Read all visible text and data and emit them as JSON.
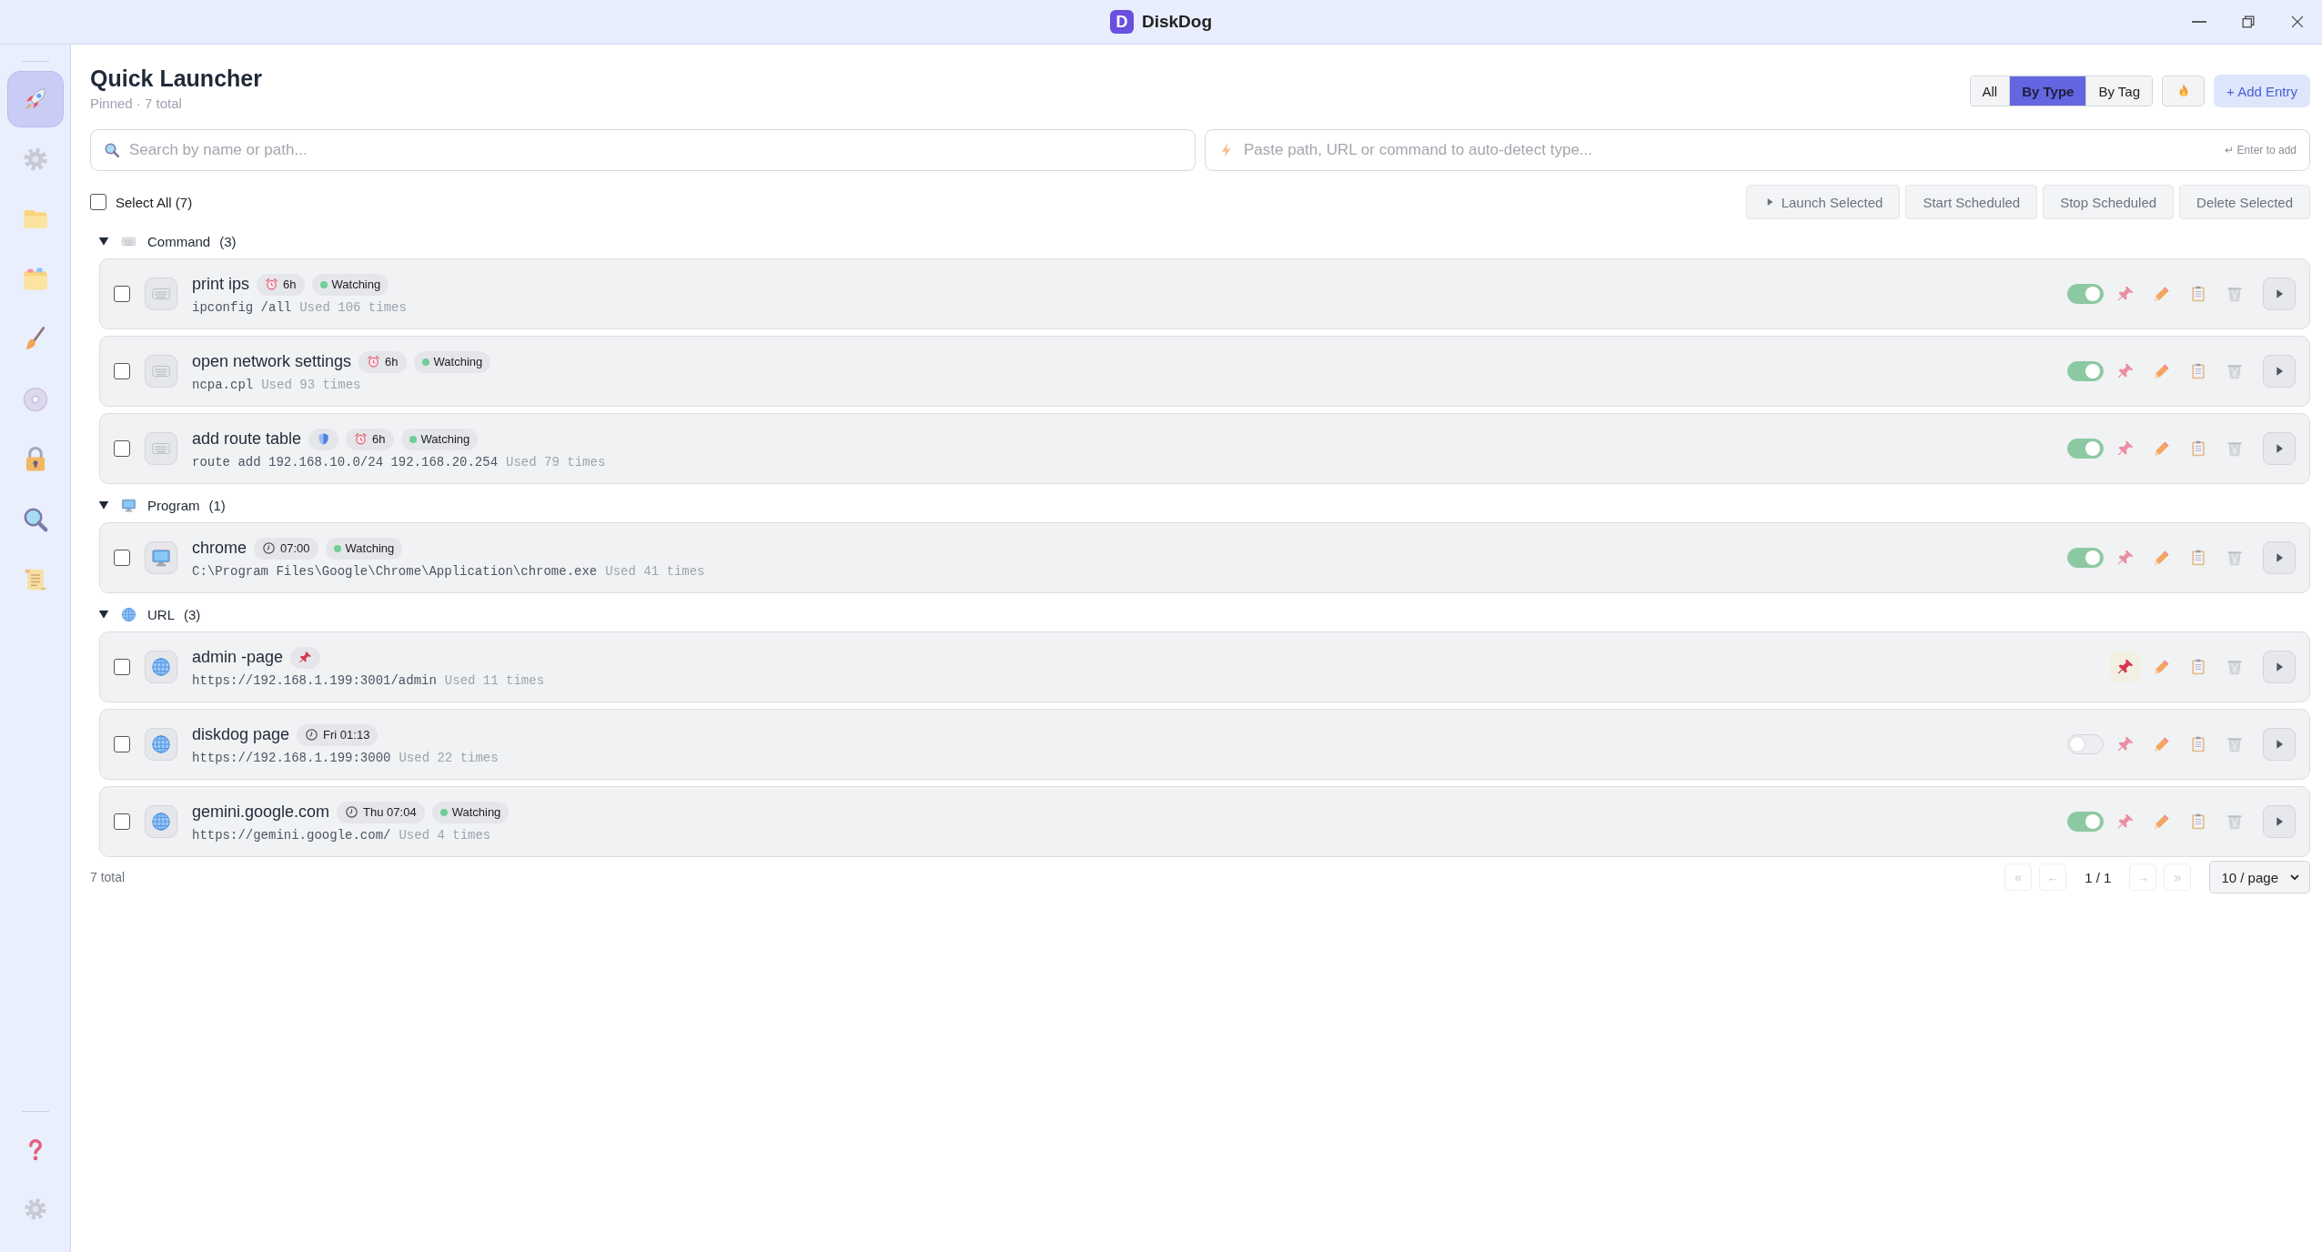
{
  "window": {
    "logo_letter": "D",
    "title": "DiskDog"
  },
  "sidebar": {
    "items": [
      {
        "selected": true
      },
      {
        "selected": false
      },
      {
        "selected": false
      },
      {
        "selected": false
      },
      {
        "selected": false
      },
      {
        "selected": false
      },
      {
        "selected": false
      },
      {
        "selected": false
      },
      {
        "selected": false
      }
    ],
    "footer_items": [
      {
        "selected": false
      },
      {
        "selected": false
      }
    ]
  },
  "header": {
    "title": "Quick Launcher",
    "subtitle": "Pinned · 7 total"
  },
  "view_tabs": [
    {
      "label": "All",
      "selected": false
    },
    {
      "label": "By Type",
      "selected": true
    },
    {
      "label": "By Tag",
      "selected": false
    }
  ],
  "add_button": "+ Add Entry",
  "search": {
    "placeholder": "Search by name or path..."
  },
  "quick_add": {
    "placeholder": "Paste path, URL or command to auto-detect type...",
    "hint": "↵ Enter to add"
  },
  "select_all": {
    "label": "Select All (7)",
    "checked": false
  },
  "bulk_actions": [
    {
      "kind": "launch",
      "label": "Launch Selected"
    },
    {
      "kind": "plain",
      "label": "Start Scheduled"
    },
    {
      "kind": "plain",
      "label": "Stop Scheduled"
    },
    {
      "kind": "plain",
      "label": "Delete Selected"
    }
  ],
  "groups": [
    {
      "name": "Command",
      "count": "(3)",
      "kind": "command",
      "expanded": true,
      "entries": [
        {
          "name": "print ips",
          "badges": [
            {
              "kind": "alarm",
              "label": "6h"
            },
            {
              "kind": "status",
              "label": "Watching"
            }
          ],
          "target": "ipconfig /all",
          "usage": "Used 106 times",
          "checked": false,
          "schedule_on": true,
          "pinned": false
        },
        {
          "name": "open network settings",
          "badges": [
            {
              "kind": "alarm",
              "label": "6h"
            },
            {
              "kind": "status",
              "label": "Watching"
            }
          ],
          "target": "ncpa.cpl",
          "usage": "Used 93 times",
          "checked": false,
          "schedule_on": true,
          "pinned": false
        },
        {
          "name": "add route table",
          "badges": [
            {
              "kind": "shield"
            },
            {
              "kind": "alarm",
              "label": "6h"
            },
            {
              "kind": "status",
              "label": "Watching"
            }
          ],
          "target": "route add 192.168.10.0/24 192.168.20.254",
          "usage": "Used 79 times",
          "checked": false,
          "schedule_on": true,
          "pinned": false
        }
      ]
    },
    {
      "name": "Program",
      "count": "(1)",
      "kind": "program",
      "expanded": true,
      "entries": [
        {
          "name": "chrome",
          "badges": [
            {
              "kind": "clock",
              "label": "07:00"
            },
            {
              "kind": "status",
              "label": "Watching"
            }
          ],
          "target": "C:\\Program Files\\Google\\Chrome\\Application\\chrome.exe",
          "usage": "Used 41 times",
          "checked": false,
          "schedule_on": true,
          "pinned": false
        }
      ]
    },
    {
      "name": "URL",
      "count": "(3)",
      "kind": "url",
      "expanded": true,
      "entries": [
        {
          "name": "admin -page",
          "badges": [
            {
              "kind": "pin"
            }
          ],
          "target": "https://192.168.1.199:3001/admin",
          "usage": "Used 11 times",
          "checked": false,
          "pinned": true
        },
        {
          "name": "diskdog page",
          "badges": [
            {
              "kind": "clock",
              "label": "Fri 01:13"
            }
          ],
          "target": "https://192.168.1.199:3000",
          "usage": "Used 22 times",
          "checked": false,
          "schedule_on": false,
          "pinned": false
        },
        {
          "name": "gemini.google.com",
          "badges": [
            {
              "kind": "clock",
              "label": "Thu 07:04"
            },
            {
              "kind": "status",
              "label": "Watching"
            }
          ],
          "target": "https://gemini.google.com/",
          "usage": "Used 4 times",
          "checked": false,
          "schedule_on": true,
          "pinned": false
        }
      ]
    }
  ],
  "footer": {
    "total": "7 total",
    "nav": [
      {
        "label": "«",
        "disabled": true
      },
      {
        "label": "←",
        "disabled": true
      },
      {
        "label": "→",
        "disabled": true
      },
      {
        "label": "»",
        "disabled": true
      }
    ],
    "page": "1 / 1",
    "page_size": "10 / page"
  }
}
